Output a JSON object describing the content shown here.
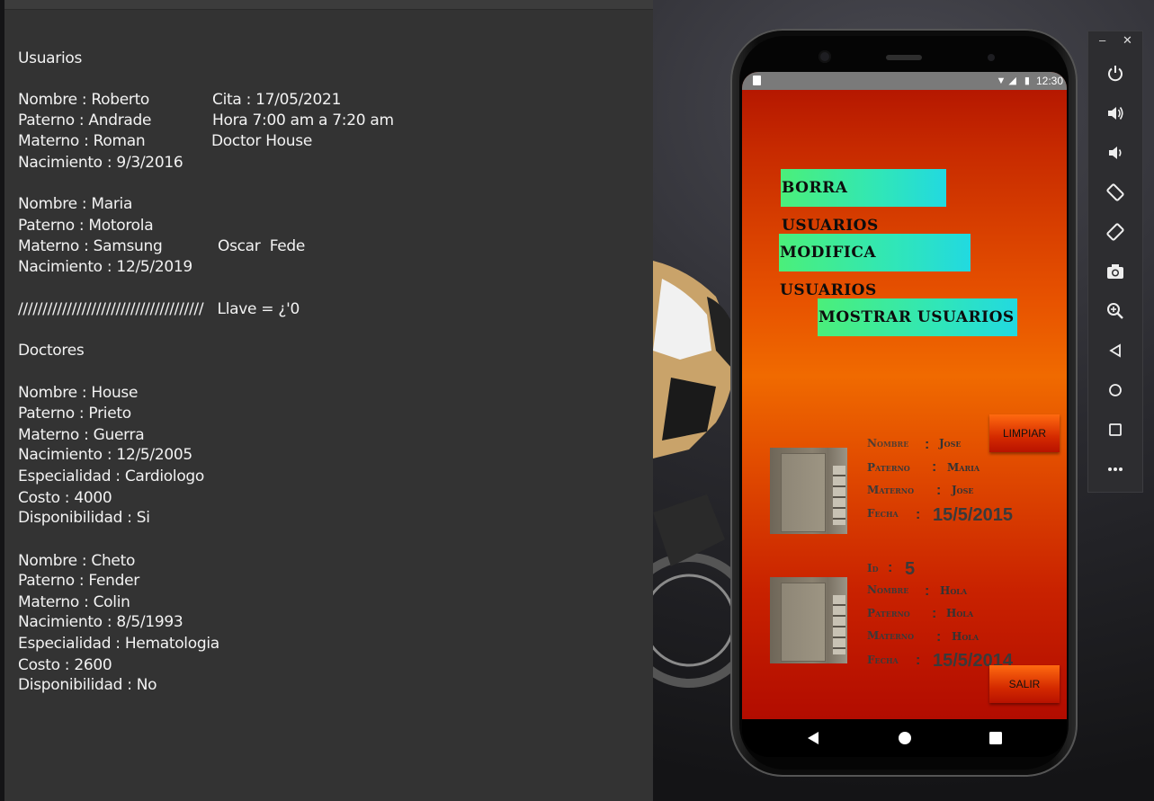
{
  "text_window": {
    "lines": [
      "Usuarios",
      "Nombre : Roberto",
      "Paterno : Andrade",
      "Materno : Roman",
      "Nacimiento : 9/3/2016",
      "Nombre : Maria",
      "Paterno : Motorola",
      "Materno : Samsung",
      "Nacimiento : 12/5/2019",
      "//////////////////////////////////////   Llave = ¿'0",
      "Doctores",
      "Nombre : House",
      "Paterno : Prieto",
      "Materno : Guerra",
      "Nacimiento : 12/5/2005",
      "Especialidad : Cardiologo",
      "Costo : 4000",
      "Disponibilidad : Si",
      "Nombre : Cheto",
      "Paterno : Fender",
      "Materno : Colin",
      "Nacimiento : 8/5/1993",
      "Especialidad : Hematologia",
      "Costo : 2600",
      "Disponibilidad : No"
    ],
    "col2": {
      "cita": "Cita : 17/05/2021",
      "hora": "Hora 7:00 am a 7:20 am",
      "doctor": "Doctor House",
      "names": "Oscar  Fede"
    }
  },
  "phone": {
    "status_time": "12:30",
    "status_icons": "▼◢ ▮",
    "buttons": {
      "borra": "BORRA USUARIOS",
      "modifica": "MODIFICA USUARIOS",
      "mostrar": "MOSTRAR USUARIOS",
      "limpiar": "LIMPIAR",
      "salir": "SALIR"
    },
    "records": [
      {
        "cut_label": "Nombre",
        "cut_value": "Jose",
        "paterno_label": "Paterno",
        "paterno": "Maria",
        "materno_label": "Materno",
        "materno": "Jose",
        "fecha_label": "Fecha",
        "fecha": "15/5/2015"
      },
      {
        "id_label": "Id",
        "id": "5",
        "nombre_label": "Nombre",
        "nombre": "Hola",
        "paterno_label": "Paterno",
        "paterno": "Hola",
        "materno_label": "Materno",
        "materno": "Hola",
        "fecha_label": "Fecha",
        "fecha": "15/5/2014"
      }
    ],
    "colon": ":"
  },
  "emulator": {
    "minimize": "–",
    "close": "✕",
    "icons": [
      "power-icon",
      "volume-up-icon",
      "volume-down-icon",
      "rotate-left-icon",
      "rotate-right-icon",
      "camera-icon",
      "zoom-icon",
      "back-icon",
      "home-icon",
      "overview-icon",
      "more-icon"
    ]
  }
}
